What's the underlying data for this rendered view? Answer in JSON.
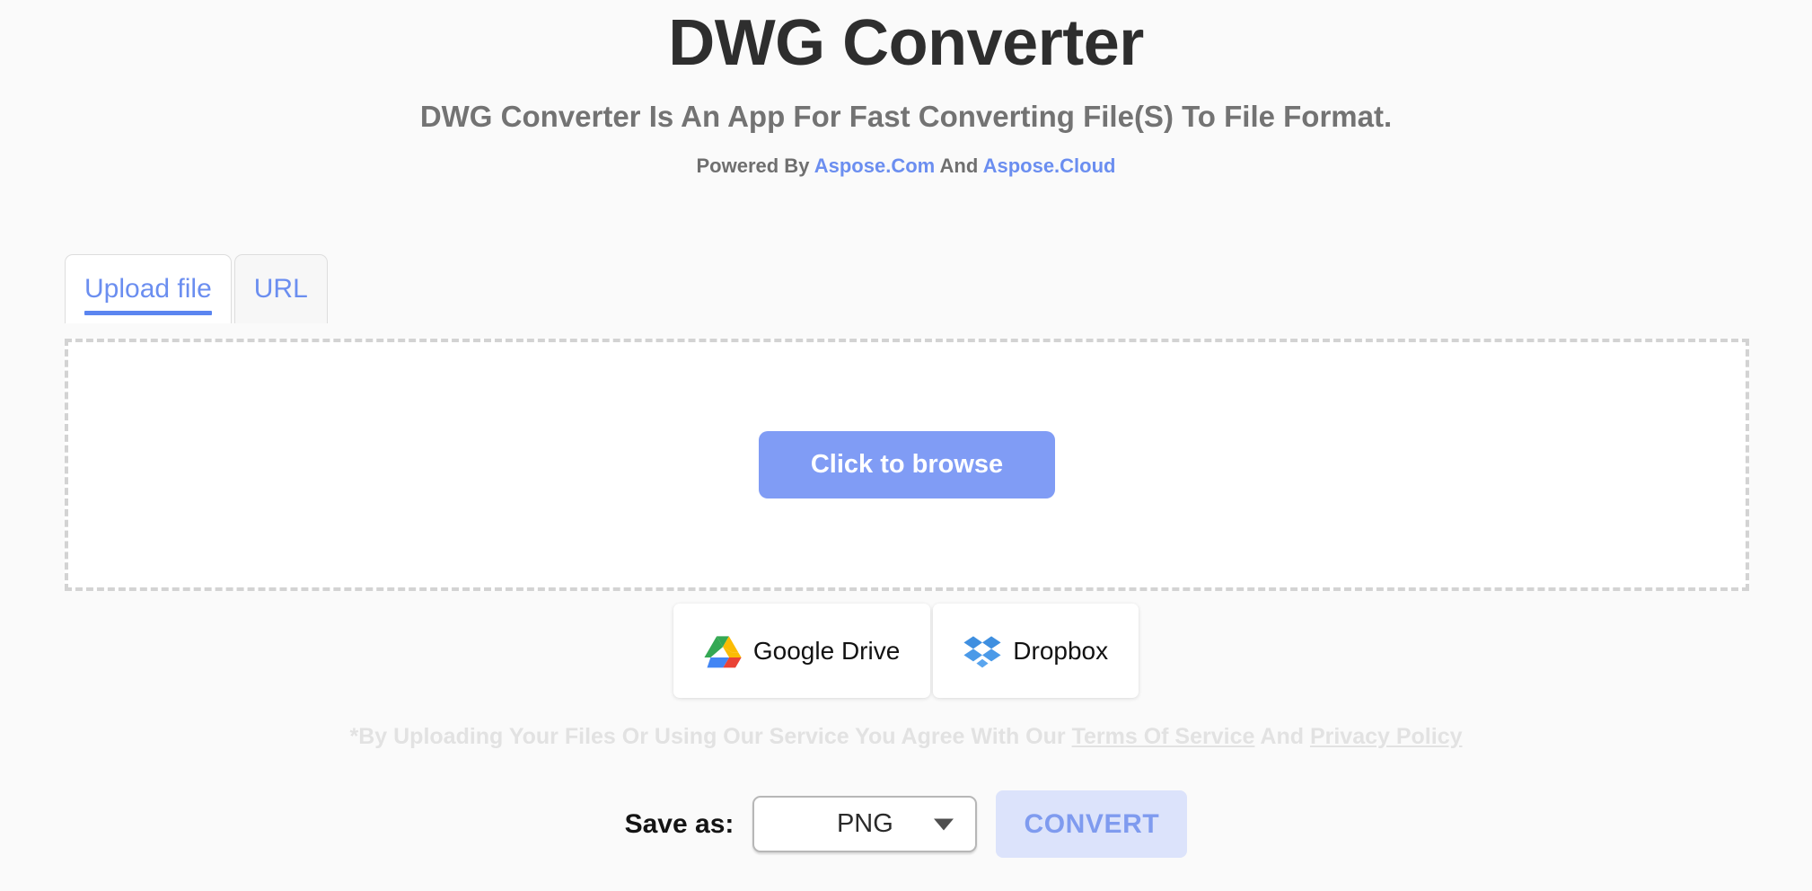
{
  "header": {
    "title": "DWG Converter",
    "subtitle": "DWG Converter Is An App For Fast Converting File(S) To File Format.",
    "powered_prefix": "Powered By ",
    "powered_link_1": "Aspose.Com",
    "powered_middle": " And ",
    "powered_link_2": "Aspose.Cloud",
    "link_color": "#6b8ef0"
  },
  "tabs": [
    {
      "label": "Upload file",
      "active": true
    },
    {
      "label": "URL",
      "active": false
    }
  ],
  "dropzone": {
    "browse_label": "Click to browse",
    "browse_bg": "#809cf5",
    "border_color": "#d3d3d3"
  },
  "cloud": [
    {
      "label": "Google Drive",
      "icon": "google-drive-icon"
    },
    {
      "label": "Dropbox",
      "icon": "dropbox-icon"
    }
  ],
  "disclaimer": {
    "prefix": "*By Uploading Your Files Or Using Our Service You Agree With Our ",
    "terms_link": "Terms Of Service",
    "middle": "  And ",
    "privacy_link": "Privacy Policy",
    "color": "#e2e2e2"
  },
  "actions": {
    "save_as_label": "Save as:",
    "format_value": "PNG",
    "format_options": [
      "PNG"
    ],
    "caret_icon": "chevron-down-icon",
    "convert_label": "CONVERT",
    "convert_bg": "#dce3fb",
    "convert_text_color": "#7f9bef",
    "convert_disabled": true
  }
}
